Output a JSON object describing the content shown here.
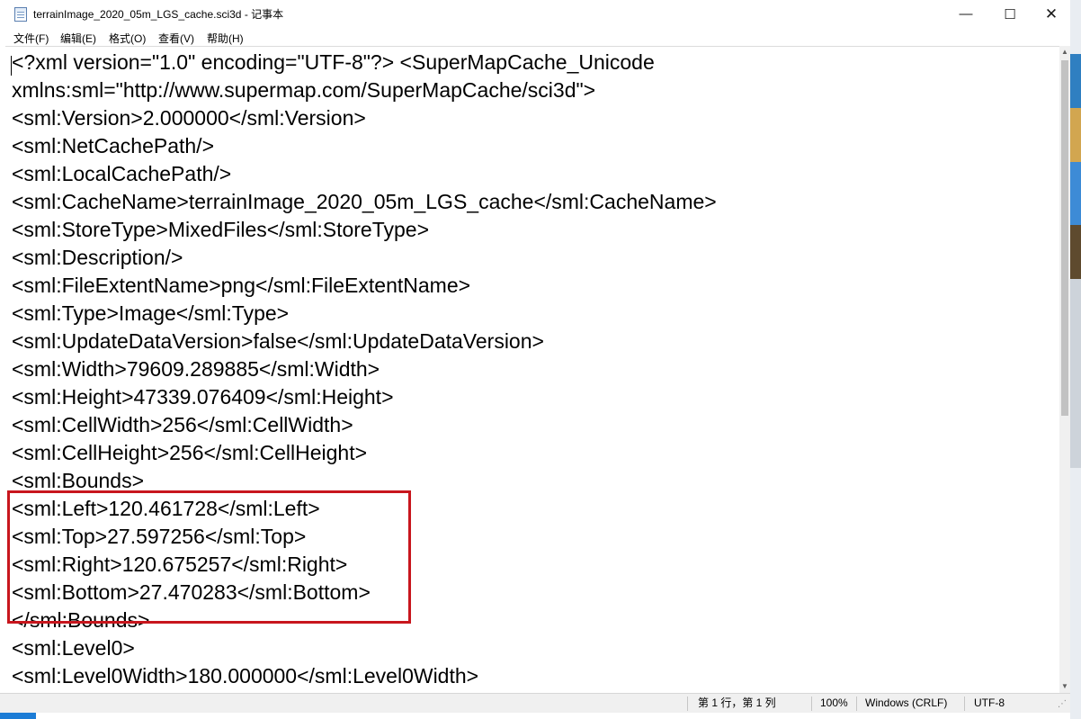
{
  "window": {
    "title": "terrainImage_2020_05m_LGS_cache.sci3d - 记事本",
    "controls": {
      "minimize": "—",
      "maximize": "☐",
      "close": "✕"
    }
  },
  "menu": [
    {
      "label": "文件(F)"
    },
    {
      "label": "编辑(E)"
    },
    {
      "label": "格式(O)"
    },
    {
      "label": "查看(V)"
    },
    {
      "label": "帮助(H)"
    }
  ],
  "editor": {
    "lines": [
      "<?xml version=\"1.0\" encoding=\"UTF-8\"?> <SuperMapCache_Unicode",
      "xmlns:sml=\"http://www.supermap.com/SuperMapCache/sci3d\">",
      "<sml:Version>2.000000</sml:Version>",
      "<sml:NetCachePath/>",
      "<sml:LocalCachePath/>",
      "<sml:CacheName>terrainImage_2020_05m_LGS_cache</sml:CacheName>",
      "<sml:StoreType>MixedFiles</sml:StoreType>",
      "<sml:Description/>",
      "<sml:FileExtentName>png</sml:FileExtentName>",
      "<sml:Type>Image</sml:Type>",
      "<sml:UpdateDataVersion>false</sml:UpdateDataVersion>",
      "<sml:Width>79609.289885</sml:Width>",
      "<sml:Height>47339.076409</sml:Height>",
      "<sml:CellWidth>256</sml:CellWidth>",
      "<sml:CellHeight>256</sml:CellHeight>",
      "<sml:Bounds>",
      "<sml:Left>120.461728</sml:Left>",
      "<sml:Top>27.597256</sml:Top>",
      "<sml:Right>120.675257</sml:Right>",
      "<sml:Bottom>27.470283</sml:Bottom>",
      "</sml:Bounds>",
      "<sml:Level0>",
      "<sml:Level0Width>180.000000</sml:Level0Width>"
    ]
  },
  "colors": {
    "highlight": "#c8161d",
    "accent": "#1c7cd6"
  },
  "status": {
    "position": "第 1 行，第 1 列",
    "zoom": "100%",
    "line_ending": "Windows (CRLF)",
    "encoding": "UTF-8"
  }
}
